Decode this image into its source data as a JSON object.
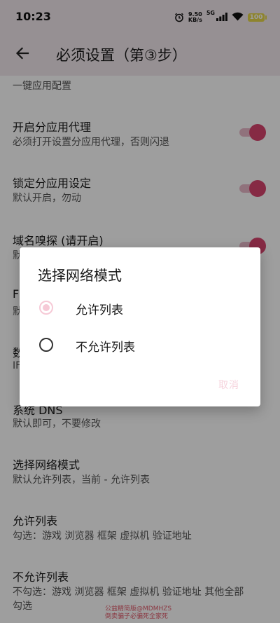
{
  "status_bar": {
    "time": "10:23",
    "speed_value": "9.50",
    "speed_unit": "KB/s",
    "network": "5G",
    "battery": "100"
  },
  "app_bar": {
    "title": "必须设置（第③步）"
  },
  "list": {
    "top_partial": "一键应用配置",
    "items": [
      {
        "title": "开启分应用代理",
        "subtitle": "必须打开设置分应用代理，否则闪退",
        "switch_on": true
      },
      {
        "title": "锁定分应用设定",
        "subtitle": "默认开启，勿动",
        "switch_on": true
      },
      {
        "title": "域名嗅探 (请开启)",
        "subtitle": "默",
        "switch_on": true
      },
      {
        "title": "F",
        "subtitle": "默"
      },
      {
        "title": "数",
        "subtitle": "IF"
      },
      {
        "title": "系统 DNS",
        "subtitle": "默认即可，不要修改"
      },
      {
        "title": "选择网络模式",
        "subtitle": "默认允许列表，当前 -  允许列表"
      },
      {
        "title": "允许列表",
        "subtitle": "勾选：游戏 浏览器 框架 虚拟机 验证地址"
      },
      {
        "title": "不允许列表",
        "subtitle": "不勾选：游戏 浏览器 框架 虚拟机 验证地址 其他全部",
        "subtitle2": "勾选"
      }
    ]
  },
  "dialog": {
    "title": "选择网络模式",
    "options": [
      {
        "label": "允许列表",
        "checked": true
      },
      {
        "label": "不允许列表",
        "checked": false
      }
    ],
    "cancel": "取消"
  },
  "watermark": {
    "line1": "公益精简版@MDMHZS",
    "line2": "倒卖骗子必骗死全家死"
  },
  "colors": {
    "accent": "#d8456e",
    "header_bg": "#f2e9ee"
  }
}
